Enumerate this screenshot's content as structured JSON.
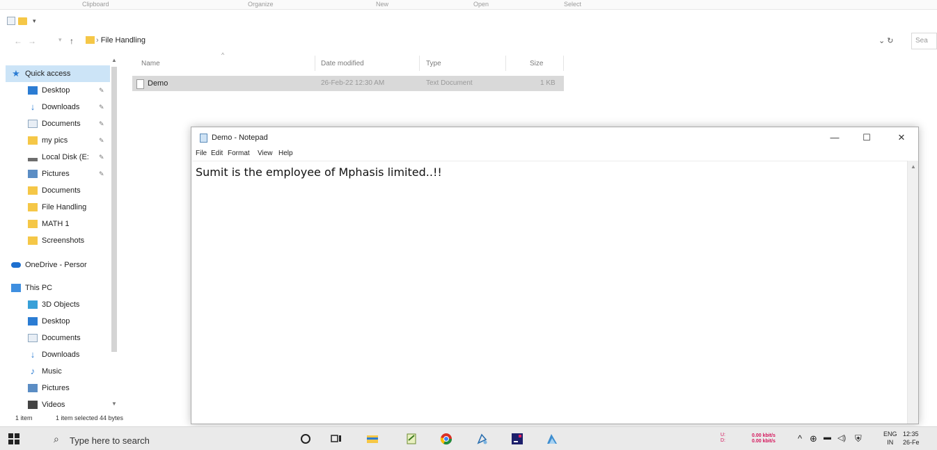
{
  "ribbon": {
    "tabs": [
      "Clipboard",
      "Organize",
      "New",
      "Open",
      "Select"
    ]
  },
  "address": {
    "path": "File Handling",
    "search_placeholder": "Sea"
  },
  "nav": {
    "items": [
      {
        "label": "Quick access",
        "icon": "star-icon",
        "pinned": false
      },
      {
        "label": "Desktop",
        "icon": "desktop-icon",
        "pinned": true
      },
      {
        "label": "Downloads",
        "icon": "download-icon",
        "pinned": true
      },
      {
        "label": "Documents",
        "icon": "documents-icon",
        "pinned": true
      },
      {
        "label": "my pics",
        "icon": "folder-icon",
        "pinned": true
      },
      {
        "label": "Local Disk (E:",
        "icon": "disk-icon",
        "pinned": true
      },
      {
        "label": "Pictures",
        "icon": "pictures-icon",
        "pinned": true
      },
      {
        "label": "Documents",
        "icon": "folder-icon",
        "pinned": false
      },
      {
        "label": "File Handling",
        "icon": "folder-icon",
        "pinned": false
      },
      {
        "label": "MATH 1",
        "icon": "folder-icon",
        "pinned": false
      },
      {
        "label": "Screenshots",
        "icon": "folder-icon",
        "pinned": false
      },
      {
        "label": "OneDrive - Persor",
        "icon": "onedrive-icon",
        "pinned": false
      },
      {
        "label": "This PC",
        "icon": "pc-icon",
        "pinned": false
      },
      {
        "label": "3D Objects",
        "icon": "3d-objects-icon",
        "pinned": false
      },
      {
        "label": "Desktop",
        "icon": "desktop-icon",
        "pinned": false
      },
      {
        "label": "Documents",
        "icon": "documents-icon",
        "pinned": false
      },
      {
        "label": "Downloads",
        "icon": "download-icon",
        "pinned": false
      },
      {
        "label": "Music",
        "icon": "music-icon",
        "pinned": false
      },
      {
        "label": "Pictures",
        "icon": "pictures-icon",
        "pinned": false
      },
      {
        "label": "Videos",
        "icon": "videos-icon",
        "pinned": false
      }
    ]
  },
  "file_list": {
    "columns": {
      "name": "Name",
      "date": "Date modified",
      "type": "Type",
      "size": "Size"
    },
    "rows": [
      {
        "name": "Demo",
        "date": "26-Feb-22 12:30 AM",
        "type": "Text Document",
        "size": "1 KB"
      }
    ]
  },
  "status": {
    "count": "1 item",
    "selected": "1 item selected  44 bytes"
  },
  "notepad": {
    "title": "Demo - Notepad",
    "menu": [
      "File",
      "Edit",
      "Format",
      "View",
      "Help"
    ],
    "content": "Sumit is the employee of Mphasis limited..!!",
    "controls": {
      "minimize": "—",
      "maximize": "☐",
      "close": "✕"
    }
  },
  "taskbar": {
    "search_placeholder": "Type here to search",
    "net_labels": [
      "U:",
      "D:"
    ],
    "net_speeds": [
      "0.00 kbit/s",
      "0.00 kbit/s"
    ],
    "lang": [
      "ENG",
      "IN"
    ],
    "clock": [
      "12:35",
      "26-Fe"
    ]
  }
}
